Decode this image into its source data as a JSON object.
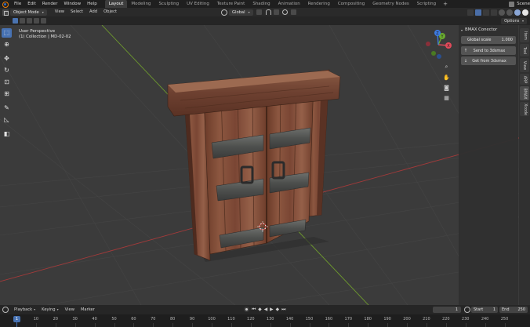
{
  "menubar": {
    "items": [
      "File",
      "Edit",
      "Render",
      "Window",
      "Help"
    ],
    "workspaces": [
      "Layout",
      "Modeling",
      "Sculpting",
      "UV Editing",
      "Texture Paint",
      "Shading",
      "Animation",
      "Rendering",
      "Compositing",
      "Geometry Nodes",
      "Scripting"
    ],
    "active_workspace": "Layout",
    "add_label": "+",
    "scene_label": "Scene"
  },
  "viewport_header": {
    "mode": "Object Mode",
    "menus": [
      "View",
      "Select",
      "Add",
      "Object"
    ],
    "orientation": "Global"
  },
  "tool_settings": {
    "options_label": "Options"
  },
  "viewport": {
    "perspective_label": "User Perspective",
    "collection_label": "(1) Collection | MD-02-02"
  },
  "toolbar": {
    "tools": [
      {
        "name": "select-box-tool",
        "glyph": "⬚",
        "active": true
      },
      {
        "name": "cursor-tool",
        "glyph": "⊕"
      },
      {
        "name": "move-tool",
        "glyph": "✥"
      },
      {
        "name": "rotate-tool",
        "glyph": "↻"
      },
      {
        "name": "scale-tool",
        "glyph": "⊡"
      },
      {
        "name": "transform-tool",
        "glyph": "⊞"
      },
      {
        "name": "annotate-tool",
        "glyph": "✎"
      },
      {
        "name": "measure-tool",
        "glyph": "◺"
      },
      {
        "name": "add-cube-tool",
        "glyph": "◧"
      }
    ]
  },
  "gizmo": {
    "x_label": "X",
    "y_label": "Y",
    "z_label": "Z",
    "x_color": "#e04a5a",
    "y_color": "#6aab2f",
    "z_color": "#3d7ae0"
  },
  "npanel": {
    "title": "BMAX Conector",
    "global_scale_label": "Global scale",
    "global_scale_value": "1.000",
    "send_button": "Send to 3dsmax",
    "get_button": "Get from 3dsmax",
    "tabs": [
      "Item",
      "Tool",
      "View",
      "ARP",
      "BMAX",
      "Xcode"
    ],
    "active_tab": "BMAX"
  },
  "timeline": {
    "menus": [
      "Playback",
      "Keying",
      "View",
      "Marker"
    ],
    "current_frame": "1",
    "start_label": "Start",
    "start_value": "1",
    "end_label": "End",
    "end_value": "250",
    "ruler_ticks": [
      "1",
      "10",
      "20",
      "30",
      "40",
      "50",
      "60",
      "70",
      "80",
      "90",
      "100",
      "110",
      "120",
      "130",
      "140",
      "150",
      "160",
      "170",
      "180",
      "190",
      "200",
      "210",
      "220",
      "230",
      "240",
      "250"
    ],
    "playhead_label": "1"
  },
  "colors": {
    "accent": "#4772b3",
    "viewport_bg": "#3b3b3b",
    "grid_x_axis": "#a33a3a",
    "grid_y_axis": "#6e9a2e"
  }
}
